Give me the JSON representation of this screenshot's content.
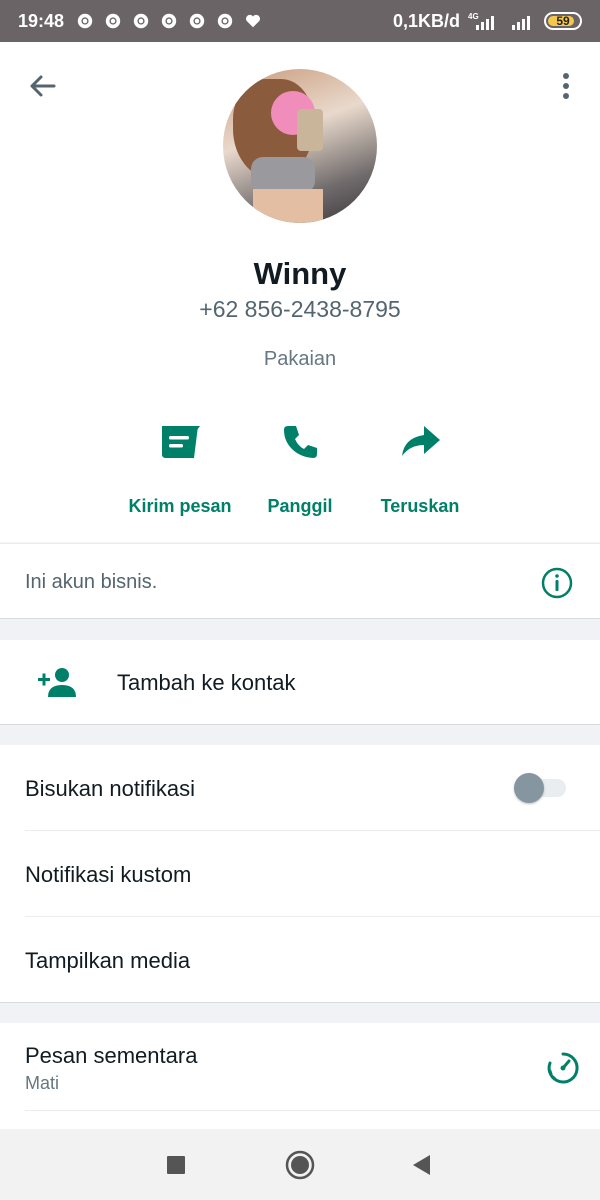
{
  "status_bar": {
    "time": "19:48",
    "network_speed": "0,1KB/d",
    "network_type": "4G",
    "battery_level": "59",
    "notification_icons": [
      "chrome-icon",
      "chrome-icon",
      "chrome-icon",
      "chrome-icon",
      "chrome-icon",
      "chrome-icon",
      "heart-icon"
    ]
  },
  "header": {
    "back_icon": "arrow-left-icon",
    "menu_icon": "more-vertical-icon"
  },
  "profile": {
    "name": "Winny",
    "phone": "+62 856-2438-8795",
    "category": "Pakaian"
  },
  "actions": [
    {
      "label": "Kirim pesan",
      "icon": "message-icon"
    },
    {
      "label": "Panggil",
      "icon": "phone-icon"
    },
    {
      "label": "Teruskan",
      "icon": "forward-icon"
    }
  ],
  "business_notice": {
    "text": "Ini akun bisnis.",
    "icon": "info-icon"
  },
  "add_contact": {
    "label": "Tambah ke kontak",
    "icon": "person-add-icon"
  },
  "notification_settings": {
    "mute_label": "Bisukan notifikasi",
    "mute_enabled": false,
    "custom_label": "Notifikasi kustom",
    "media_label": "Tampilkan media"
  },
  "disappearing": {
    "label": "Pesan sementara",
    "value": "Mati",
    "icon": "timer-icon"
  },
  "nav_bar": {
    "recents_icon": "square-icon",
    "home_icon": "circle-icon",
    "back_icon": "triangle-back-icon"
  },
  "colors": {
    "accent": "#008069",
    "status_bar": "#6a6467",
    "background": "#f0f2f5"
  }
}
